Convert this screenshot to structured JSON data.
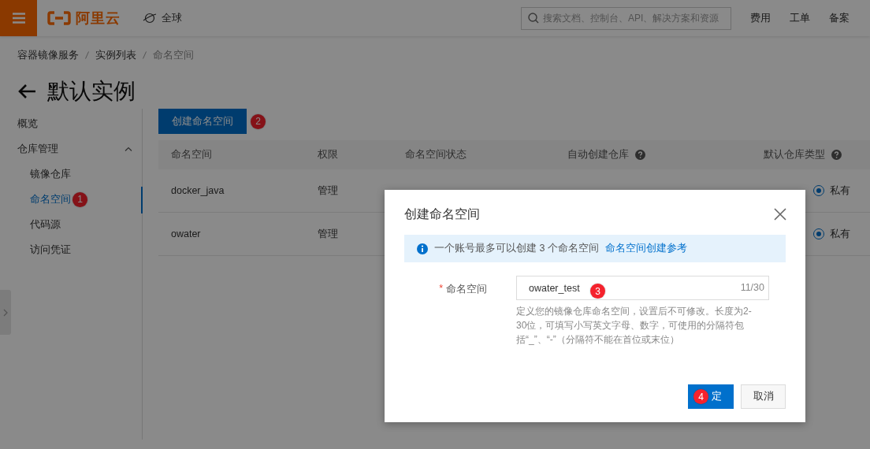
{
  "header": {
    "logo_text": "阿里云",
    "region": "全球",
    "search": {
      "placeholder": "搜索文档、控制台、API、解决方案和资源"
    },
    "links": [
      "费用",
      "工单",
      "备案"
    ]
  },
  "breadcrumb": [
    {
      "label": "容器镜像服务",
      "current": false
    },
    {
      "label": "实例列表",
      "current": false
    },
    {
      "label": "命名空间",
      "current": true
    }
  ],
  "page_title": "默认实例",
  "sidebar": {
    "items": [
      {
        "label": "概览",
        "selected": false
      },
      {
        "label": "仓库管理",
        "expanded": true,
        "children": [
          {
            "label": "镜像仓库",
            "selected": false
          },
          {
            "label": "命名空间",
            "selected": true,
            "badge": "1"
          },
          {
            "label": "代码源",
            "selected": false
          },
          {
            "label": "访问凭证",
            "selected": false
          }
        ]
      }
    ]
  },
  "create_button": {
    "label": "创建命名空间",
    "badge": "2"
  },
  "table": {
    "columns": [
      {
        "label": "命名空间",
        "help": false
      },
      {
        "label": "权限",
        "help": false
      },
      {
        "label": "命名空间状态",
        "help": false
      },
      {
        "label": "自动创建仓库",
        "help": true
      },
      {
        "label": "默认仓库类型",
        "help": true
      }
    ],
    "rows": [
      {
        "namespace": "docker_java",
        "permission": "管理",
        "repo_type": {
          "label": "私有",
          "checked": true
        }
      },
      {
        "namespace": "owater",
        "permission": "管理",
        "repo_type": {
          "label": "私有",
          "checked": true
        }
      }
    ]
  },
  "dialog": {
    "title": "创建命名空间",
    "notice": {
      "text": "一个账号最多可以创建 3 个命名空间",
      "link": "命名空间创建参考"
    },
    "field": {
      "label": "命名空间",
      "required_mark": "*",
      "value": "owater_test",
      "counter": "11/30",
      "badge": "3",
      "help": "定义您的镜像仓库命名空间，设置后不可修改。长度为2-30位，可填写小写英文字母、数字，可使用的分隔符包括“_”、“-”（分隔符不能在首位或末位）"
    },
    "buttons": [
      {
        "label": "定",
        "kind": "primary",
        "badge": "4"
      },
      {
        "label": "取消",
        "kind": "secondary"
      }
    ]
  }
}
